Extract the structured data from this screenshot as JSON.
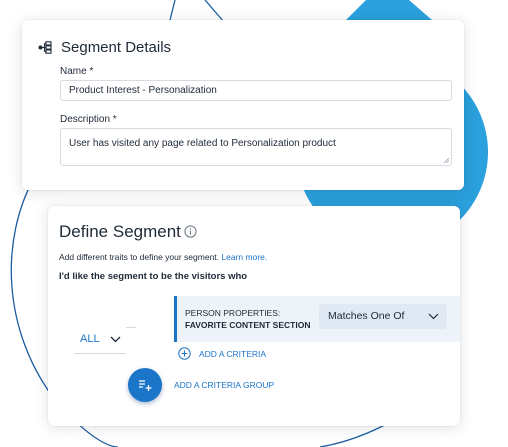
{
  "colors": {
    "accent": "#1b75c9",
    "decor_circle": "#2aa0dc",
    "decor_line": "#1b5d9e"
  },
  "details": {
    "title": "Segment Details",
    "title_icon": "segment-tree-icon",
    "name_label": "Name *",
    "name_value": "Product Interest - Personalization",
    "description_label": "Description *",
    "description_value": "User has visited any page related to Personalization product"
  },
  "define": {
    "title": "Define Segment",
    "info_icon": "info-icon",
    "help_text": "Add different traits to define your segment.",
    "learn_more": "Learn more.",
    "visitors_text": "I'd like the segment to be the visitors who",
    "logic_operator": "ALL",
    "criteria": {
      "property_category": "PERSON PROPERTIES:",
      "property_name": "FAVORITE CONTENT SECTION",
      "operator": "Matches One Of"
    },
    "add_criteria": "ADD A CRITERIA",
    "add_criteria_group": "ADD A CRITERIA GROUP"
  }
}
